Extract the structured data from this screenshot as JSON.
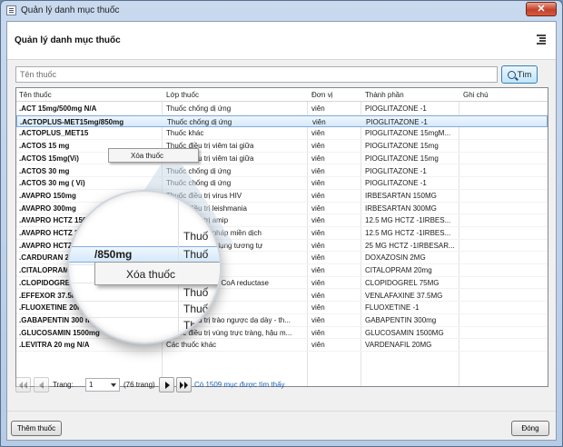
{
  "window": {
    "title": "Quản lý danh mục thuốc",
    "close_label": "✕"
  },
  "header": {
    "title": "Quản lý danh mục thuốc"
  },
  "search": {
    "placeholder": "Tên thuốc",
    "value": "",
    "button_label": "Tìm"
  },
  "grid": {
    "columns": [
      "Tên thuốc",
      "Lớp thuốc",
      "Đơn vị",
      "Thành phần",
      "Ghi chú"
    ],
    "rows": [
      [
        ".ACT  15mg/500mg N/A",
        "Thuốc chống dị ứng",
        "viên",
        "PIOGLITAZONE -1",
        ""
      ],
      [
        ".ACTOPLUS-MET15mg/850mg",
        "Thuốc chống dị ứng",
        "viên",
        "PIOGLITAZONE -1",
        ""
      ],
      [
        ".ACTOPLUS_MET15",
        "Thuốc khác",
        "viên",
        "PIOGLITAZONE 15mgM...",
        ""
      ],
      [
        ".ACTOS 15 mg",
        "Thuốc điều trị viêm tai giữa",
        "viên",
        "PIOGLITAZONE 15mg",
        ""
      ],
      [
        ".ACTOS 15mg(Vi)",
        "Thuốc điều trị viêm tai giữa",
        "viên",
        "PIOGLITAZONE 15mg",
        ""
      ],
      [
        ".ACTOS 30 mg",
        "Thuốc chống dị ứng",
        "viên",
        "PIOGLITAZONE -1",
        ""
      ],
      [
        ".ACTOS 30 mg ( Vi)",
        "Thuốc chống dị ứng",
        "viên",
        "PIOGLITAZONE -1",
        ""
      ],
      [
        ".AVAPRO 150mg",
        "Thuốc điều trị virus HIV",
        "viên",
        "IRBESARTAN 150MG",
        ""
      ],
      [
        ".AVAPRO 300mg",
        "Thuốc điều trị leishmania",
        "viên",
        "IRBESARTAN 300MG",
        ""
      ],
      [
        ".AVAPRO HCTZ  150",
        "Thuốc điều trị amip",
        "viên",
        "12.5 MG HCTZ -1IRBES...",
        ""
      ],
      [
        ".AVAPRO HCTZ 30",
        "Thuốc điều trị pháp miền dịch",
        "viên",
        "12.5 MG HCTZ -1IRBES...",
        ""
      ],
      [
        ".AVAPRO HCTZ 30",
        "Thuốc chất tác dụng tương tự",
        "viên",
        "25 MG HCTZ -1IRBESAR...",
        ""
      ],
      [
        ".CARDURAN 2mg",
        "Thuốc khác",
        "viên",
        "DOXAZOSIN 2MG",
        ""
      ],
      [
        ".CITALOPRAM 20m",
        "Thuốc khác",
        "viên",
        "CITALOPRAM 20mg",
        ""
      ],
      [
        ".CLOPIDOGREL75 m",
        "Thuốc chế HMG CoA reductase",
        "viên",
        "CLOPIDOGREL 75MG",
        ""
      ],
      [
        ".EFFEXOR 37.5mg",
        "Thuốc khác",
        "viên",
        "VENLAFAXINE 37.5MG",
        ""
      ],
      [
        ".FLUOXETINE 20mg",
        "Thuốc khác",
        "viên",
        "FLUOXETINE -1",
        ""
      ],
      [
        ".GABAPENTIN 300 mg",
        "Thuốc điều trị trào ngược dạ dày - th...",
        "viên",
        "GABAPENTIN 300mg",
        ""
      ],
      [
        ".GLUCOSAMIN 1500mg",
        "Thuốc điều trị vùng trực tràng, hậu m...",
        "viên",
        "GLUCOSAMIN 1500MG",
        ""
      ],
      [
        ".LEVITRA 20 mg N/A",
        "Các thuốc khác",
        "viên",
        "VARDENAFIL 20MG",
        ""
      ]
    ],
    "selected_row": 1
  },
  "context_menu": {
    "delete_label": "Xóa thuốc"
  },
  "magnifier": {
    "lines": [
      "Thuố",
      "/850mg",
      "Thuố",
      "Thuố",
      "Thuố",
      "Thuố",
      "Thuố"
    ]
  },
  "pager": {
    "page_label": "Trang:",
    "page_value": "1",
    "total_pages": "(76 trang)",
    "found_text": "Có 1509 mục được tìm thấy"
  },
  "footer": {
    "add_label": "Thêm thuốc",
    "close_label": "Đóng"
  }
}
